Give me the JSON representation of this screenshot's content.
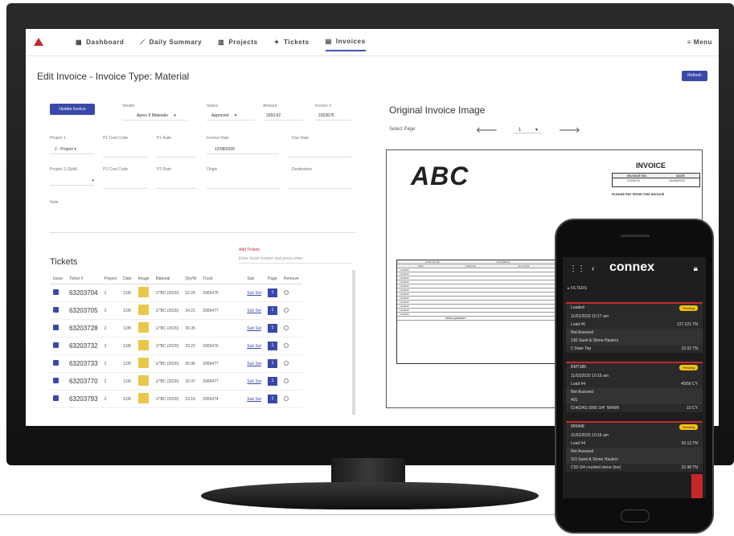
{
  "nav": {
    "items": [
      {
        "label": "Dashboard",
        "icon": "grid-icon"
      },
      {
        "label": "Daily Summary",
        "icon": "trend-icon"
      },
      {
        "label": "Projects",
        "icon": "building-icon"
      },
      {
        "label": "Tickets",
        "icon": "ticket-icon"
      },
      {
        "label": "Invoices",
        "icon": "document-icon"
      }
    ],
    "menu_label": "Menu"
  },
  "page": {
    "title": "Edit Invoice - Invoice Type: Material",
    "refresh_label": "Refresh",
    "update_label": "Update Invoice"
  },
  "form": {
    "vendor_label": "Vendor",
    "vendor_value": "Aprex 8 Materials",
    "status_label": "Status",
    "status_value": "Approved",
    "amount_label": "Amount",
    "amount_value": "3260.62",
    "invoice_label": "Invoice #",
    "invoice_value": "2332675",
    "project_label": "Project 1",
    "project_value": "2 - Project",
    "p1code_label": "P1 Cost Code",
    "p1rate_label": "P1 Rate",
    "invdate_label": "Invoice Date",
    "invdate_value": "12/08/2020",
    "duedate_label": "Due Date",
    "project2_label": "Project 2 (Split)",
    "p2code_label": "P2 Cost Code",
    "p2rate_label": "P2 Rate",
    "origin_label": "Origin",
    "dest_label": "Destination",
    "note_label": "Note"
  },
  "tickets": {
    "title": "Tickets",
    "add_label": "Add Tickets",
    "search_placeholder": "Enter ticket number and press enter",
    "headers": [
      "Issue",
      "Ticket #",
      "Project",
      "Date",
      "Image",
      "Material",
      "Qty/W",
      "Truck",
      "Sub",
      "Page",
      "Remove"
    ],
    "rows": [
      {
        "ticket": "63203704",
        "project": "2",
        "date": "12/8",
        "material": "1/\"BC (2020)",
        "qty": "32.24",
        "truck": "2069476",
        "sub": "Sub Set",
        "page": "1"
      },
      {
        "ticket": "63203705",
        "project": "2",
        "date": "12/8",
        "material": "1/\"BC (2020)",
        "qty": "34.21",
        "truck": "2069477",
        "sub": "Sub Set",
        "page": "1"
      },
      {
        "ticket": "63203728",
        "project": "2",
        "date": "12/8",
        "material": "1/\"BC (2020)",
        "qty": "30.35",
        "truck": "",
        "sub": "Sub Set",
        "page": "1"
      },
      {
        "ticket": "63203732",
        "project": "2",
        "date": "12/8",
        "material": "1/\"BC (2020)",
        "qty": "33.23",
        "truck": "2069476",
        "sub": "Sub Set",
        "page": "1"
      },
      {
        "ticket": "63203733",
        "project": "2",
        "date": "12/8",
        "material": "1/\"BC (2020)",
        "qty": "30.96",
        "truck": "2069477",
        "sub": "Sub Set",
        "page": "1"
      },
      {
        "ticket": "63203770",
        "project": "2",
        "date": "12/8",
        "material": "1/\"BC (2020)",
        "qty": "32.47",
        "truck": "2069477",
        "sub": "Sub Set",
        "page": "1"
      },
      {
        "ticket": "63203793",
        "project": "2",
        "date": "12/8",
        "material": "1/\"BC (2020)",
        "qty": "33.18",
        "truck": "2069474",
        "sub": "Sub Set",
        "page": "1"
      }
    ]
  },
  "original": {
    "title": "Original Invoice Image",
    "select_label": "Select Page:",
    "page_value": "1",
    "logo_text": "ABC",
    "invoice_heading": "INVOICE",
    "invoice_no_label": "INVOICE NO.",
    "date_label": "DATE",
    "invoice_no": "2332675",
    "invoice_date": "12/08/2020",
    "pay_text": "PLEASE PAY FROM THIS INVOICE",
    "table_headers": [
      "Customer No.",
      "Job Address",
      "Purchase"
    ],
    "table_cols": [
      "Date",
      "Ticket No.",
      "Item Code",
      "Description"
    ],
    "table_rows": [
      "12/08/20",
      "12/08/20",
      "12/08/20",
      "12/08/20",
      "12/08/20",
      "12/08/20",
      "12/08/20",
      "12/08/20",
      "12/08/20",
      "12/08/20",
      "12/08/20",
      "12/08/20"
    ],
    "total_label": "TOTAL QUANTITY"
  },
  "phone": {
    "brand": "connex",
    "filters": "FILTERS",
    "cards": [
      {
        "head": "Loaded",
        "badge": "Pending",
        "time": "11/02/2020 10:17 am",
        "load": "Load #6",
        "qty": "127.221 TN",
        "assoc": "Not Assosed",
        "hauler": "130 Sand & Stone Haulers",
        "mat": "5 State Top",
        "amt": "15.02 TN"
      },
      {
        "head": "RMT385",
        "badge": "Pending",
        "time": "11/02/2020 10:16 am",
        "load": "Load #4",
        "qty": "45/56 CY",
        "assoc": "Not Assosed",
        "hauler": "401",
        "mat": "514024G 5000 3/4\" NRWR",
        "amt": "10 CY"
      },
      {
        "head": "855848",
        "badge": "Pending",
        "time": "11/02/2020 10:16 am",
        "load": "Load #4",
        "qty": "93.13 TN",
        "assoc": "Not Assosed",
        "hauler": "110 Sand & Stone Haulers",
        "mat": "C55-3/4 crushed stone (ton)",
        "amt": "22.98 TN"
      }
    ]
  }
}
